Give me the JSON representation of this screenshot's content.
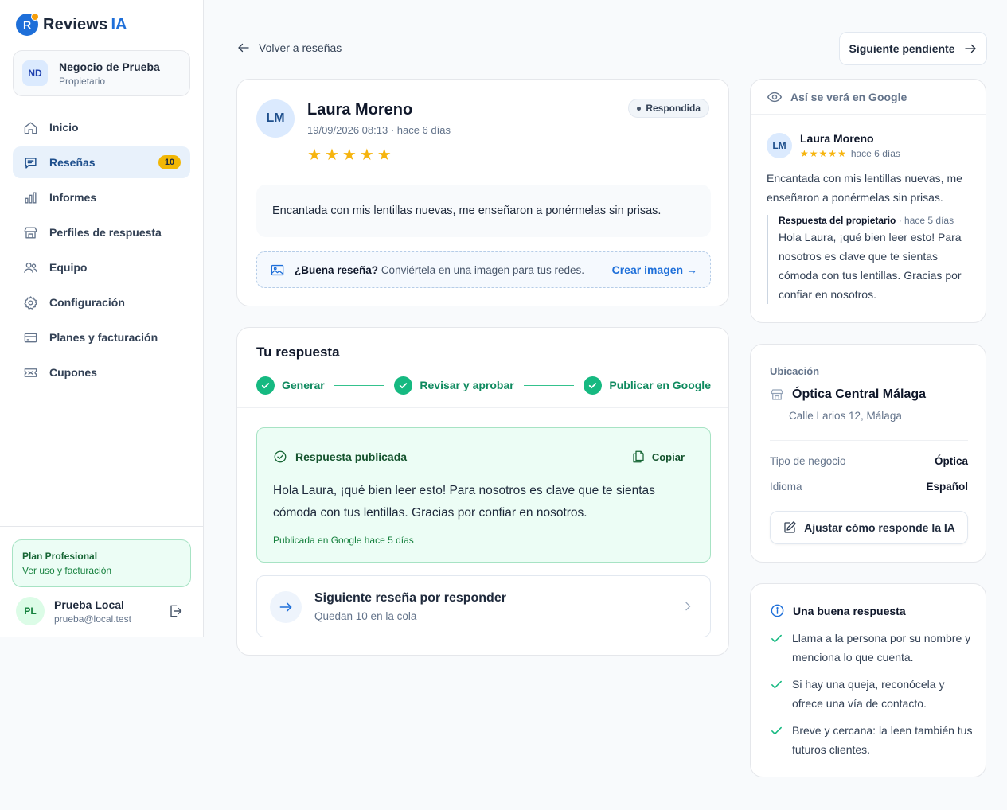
{
  "brand": {
    "letter": "R",
    "name": "Reviews",
    "suffix": "IA"
  },
  "business": {
    "initials": "ND",
    "name": "Negocio de Prueba",
    "role": "Propietario"
  },
  "nav": [
    {
      "label": "Inicio",
      "icon": "home-icon"
    },
    {
      "label": "Reseñas",
      "icon": "chat-icon",
      "badge": "10",
      "active": true
    },
    {
      "label": "Informes",
      "icon": "bar-chart-icon"
    },
    {
      "label": "Perfiles de respuesta",
      "icon": "store-icon"
    },
    {
      "label": "Equipo",
      "icon": "users-icon"
    },
    {
      "label": "Configuración",
      "icon": "gear-icon"
    },
    {
      "label": "Planes y facturación",
      "icon": "credit-card-icon"
    },
    {
      "label": "Cupones",
      "icon": "ticket-icon"
    }
  ],
  "plan": {
    "title": "Plan Profesional",
    "link": "Ver uso y facturación"
  },
  "user": {
    "initials": "PL",
    "name": "Prueba Local",
    "email": "prueba@local.test"
  },
  "topbar": {
    "back_label": "Volver a reseñas",
    "next_label": "Siguiente pendiente"
  },
  "review": {
    "initials": "LM",
    "author": "Laura Moreno",
    "date": "19/09/2026 08:13 · hace 6 días",
    "rating": 5,
    "status": "Respondida",
    "text": "Encantada con mis lentillas nuevas, me enseñaron a ponérmelas sin prisas.",
    "promo_strong": "¿Buena reseña?",
    "promo_text": "Conviértela en una imagen para tus redes.",
    "promo_link": "Crear imagen →"
  },
  "response": {
    "title": "Tu respuesta",
    "steps": [
      "Generar",
      "Revisar y aprobar",
      "Publicar en Google"
    ],
    "published_label": "Respuesta publicada",
    "copy_label": "Copiar",
    "text": "Hola Laura, ¡qué bien leer esto! Para nosotros es clave que te sientas cómoda con tus lentillas. Gracias por confiar en nosotros.",
    "published_note": "Publicada en Google hace 5 días",
    "next_title": "Siguiente reseña por responder",
    "next_sub": "Quedan 10 en la cola"
  },
  "preview": {
    "header": "Así se verá en Google",
    "initials": "LM",
    "author": "Laura Moreno",
    "time": "hace 6 días",
    "text": "Encantada con mis lentillas nuevas, me enseñaron a ponérmelas sin prisas.",
    "owner_label": "Respuesta del propietario",
    "owner_time": "· hace 5 días",
    "owner_text": "Hola Laura, ¡qué bien leer esto! Para nosotros es clave que te sientas cómoda con tus lentillas. Gracias por confiar en nosotros."
  },
  "location": {
    "label": "Ubicación",
    "name": "Óptica Central Málaga",
    "address": "Calle Larios 12, Málaga",
    "type_label": "Tipo de negocio",
    "type_value": "Óptica",
    "lang_label": "Idioma",
    "lang_value": "Español",
    "adjust_label": "Ajustar cómo responde la IA"
  },
  "tips": {
    "title": "Una buena respuesta",
    "items": [
      "Llama a la persona por su nombre y menciona lo que cuenta.",
      "Si hay una queja, reconócela y ofrece una vía de contacto.",
      "Breve y cercana: la leen también tus futuros clientes."
    ]
  },
  "colors": {
    "accent": "#1e6fd9",
    "success": "#16b981",
    "star": "#f6b40e",
    "badge": "#f2b705"
  }
}
